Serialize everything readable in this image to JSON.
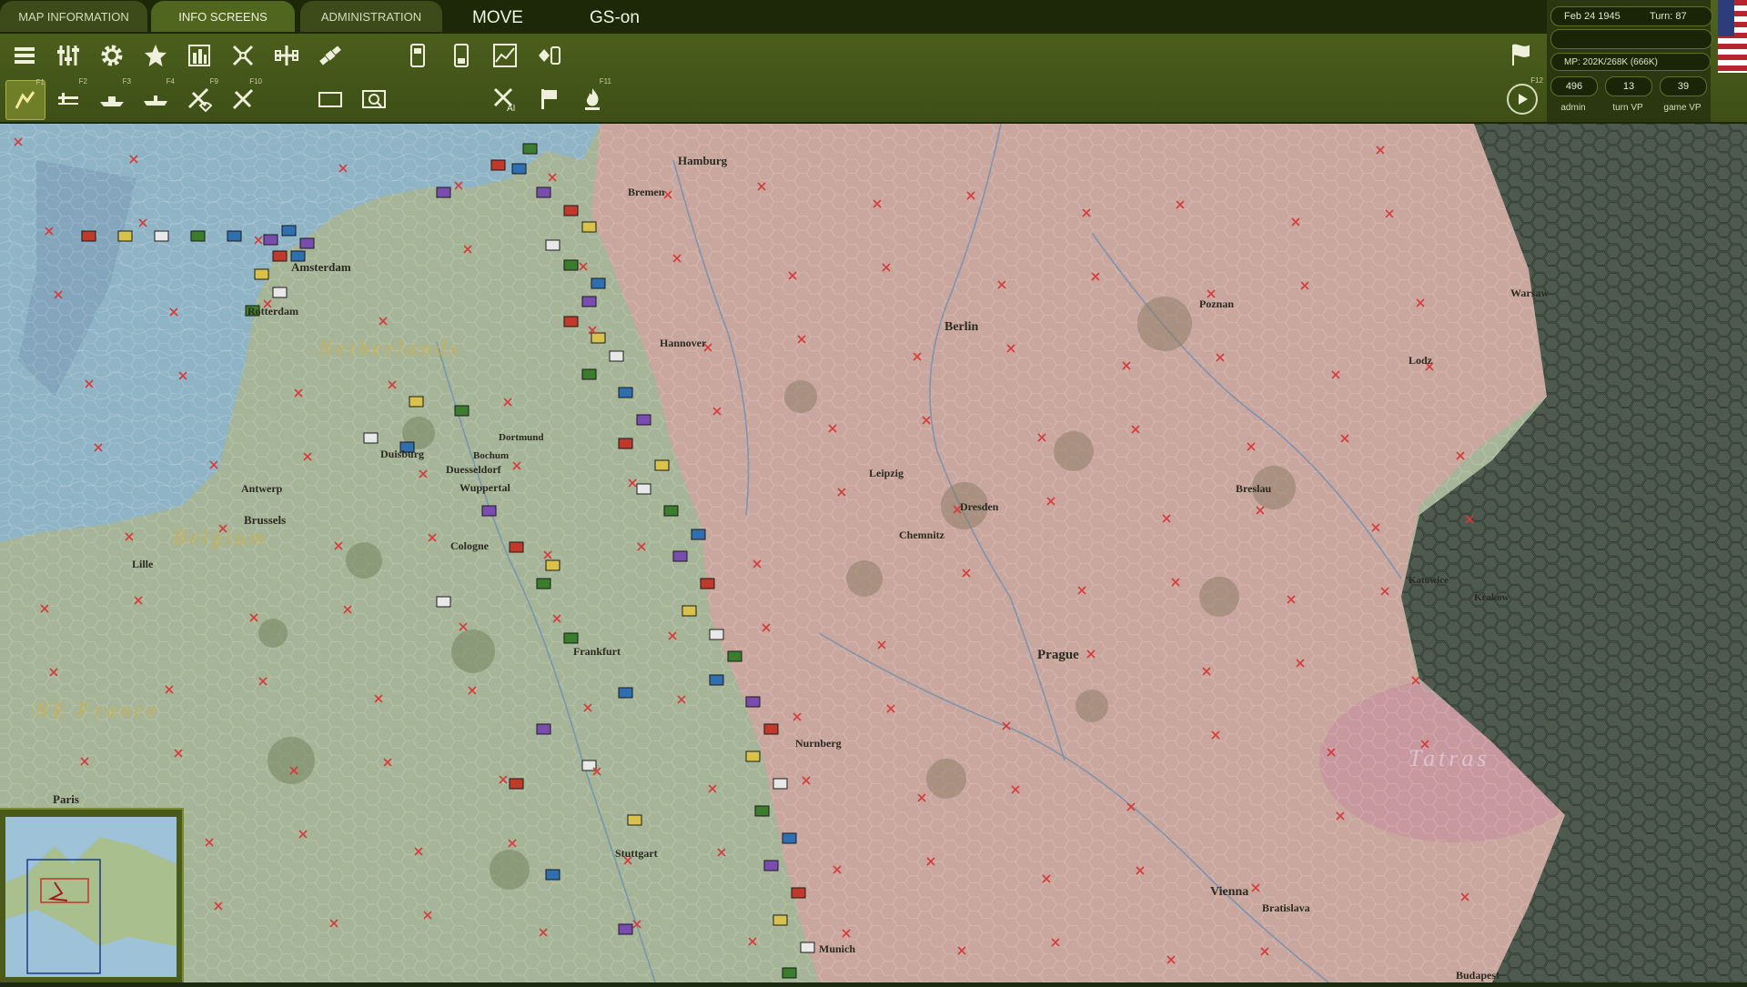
{
  "tabs": {
    "map_info": "MAP INFORMATION",
    "info_screens": "INFO SCREENS",
    "administration": "ADMINISTRATION"
  },
  "modes": {
    "move": "MOVE",
    "gs": "GS-on"
  },
  "toolbar": {
    "row1_icons": [
      "hq-stack-icon",
      "sliders-icon",
      "gear-icon",
      "star-icon",
      "city-icon",
      "air-strike-icon",
      "cross-plus-icon",
      "satellite-icon",
      "card-1-icon",
      "card-2-icon",
      "chart-icon",
      "diamond-card-icon"
    ],
    "row2_icons": [
      "unit-mode-icon",
      "air-mode-icon",
      "naval-mode-icon",
      "ship-mode-icon",
      "paradrop-icon",
      "hammer-icon",
      "hex-outline-icon",
      "zoom-box-icon",
      "ai-strike-icon",
      "flag-icon",
      "fire-icon"
    ],
    "fkeys": [
      "F1",
      "F2",
      "F3",
      "F4",
      "F9",
      "F10",
      "F11",
      "F12"
    ]
  },
  "status": {
    "date": "Feb 24 1945",
    "turn": "Turn: 87",
    "mp": "MP: 202K/268K (666K)",
    "admin_value": "496",
    "admin_label": "admin",
    "turn_vp_value": "13",
    "turn_vp_label": "turn VP",
    "game_vp_value": "39",
    "game_vp_label": "game VP"
  },
  "map": {
    "cities": [
      "Hamburg",
      "Bremen",
      "Amsterdam",
      "Rotterdam",
      "Hannover",
      "Berlin",
      "Poznan",
      "Warsaw",
      "Lodz",
      "Duisburg",
      "Dortmund",
      "Bochum",
      "Duesseldorf",
      "Wuppertal",
      "Antwerp",
      "Brussels",
      "Lille",
      "Cologne",
      "Leipzig",
      "Dresden",
      "Chemnitz",
      "Breslau",
      "Katowice",
      "Krakow",
      "Frankfurt",
      "Prague",
      "Stuttgart",
      "Nurnberg",
      "Munich",
      "Vienna",
      "Bratislava",
      "Paris",
      "Budapest"
    ],
    "regions": [
      "Netherlands",
      "Belgium",
      "NE France",
      "Tatras"
    ]
  },
  "colors": {
    "allied_land": "#a6b598",
    "axis_land": "#c9a79e",
    "soviet_land": "#4e5a4e",
    "sea": "#8fb4c6",
    "toolbar": "#4b5f1c",
    "allied_counter": "#3a7d2c"
  }
}
